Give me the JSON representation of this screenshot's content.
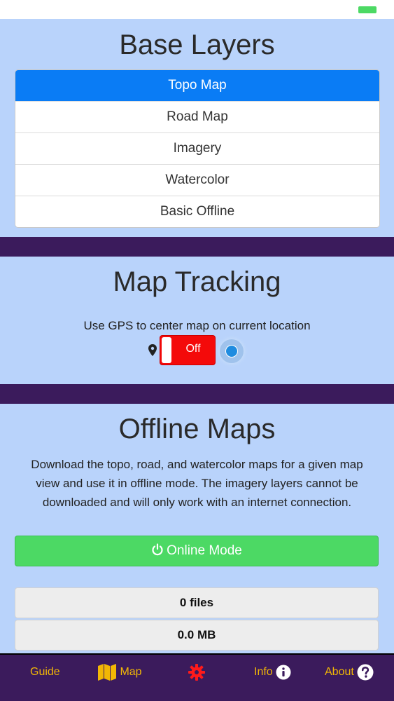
{
  "base_layers": {
    "title": "Base Layers",
    "items": [
      "Topo Map",
      "Road Map",
      "Imagery",
      "Watercolor",
      "Basic Offline"
    ],
    "selected_index": 0
  },
  "map_tracking": {
    "title": "Map Tracking",
    "description": "Use GPS to center map on current location",
    "toggle_label": "Off"
  },
  "offline_maps": {
    "title": "Offline Maps",
    "description": "Download the topo, road, and watercolor maps for a given map view and use it in offline mode. The imagery layers cannot be downloaded and will only work with an internet connection.",
    "mode_button_label": "Online Mode",
    "files_count": "0 files",
    "storage_size": "0.0 MB"
  },
  "tabbar": {
    "guide": "Guide",
    "map": "Map",
    "info": "Info",
    "about": "About"
  },
  "icons": {
    "pin": "map-pin-icon",
    "locate": "locate-icon",
    "power": "power-icon",
    "map": "map-icon",
    "settings": "gear-icon",
    "info": "info-icon",
    "about": "question-icon"
  },
  "colors": {
    "section_bg": "#b9d3fb",
    "divider": "#3b1b5c",
    "active_item": "#0a7cf5",
    "toggle_off": "#f40a0a",
    "online_button": "#4cd964",
    "tab_label": "#f2b705",
    "settings_icon": "#ff1a1a"
  }
}
